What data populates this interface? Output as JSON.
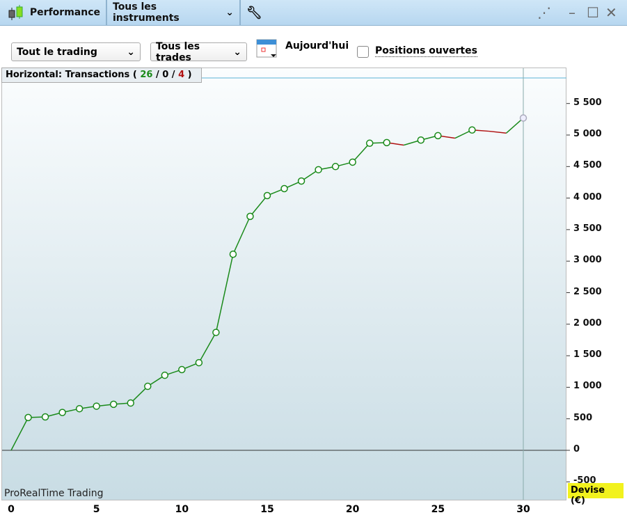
{
  "topbar": {
    "title": "Performance",
    "instruments": "Tous les instruments",
    "instruments_chevron": "⌄"
  },
  "filters": {
    "scope": "Tout le trading",
    "trades": "Tous les trades",
    "date": "Aujourd'hui",
    "open_positions": "Positions ouvertes",
    "open_positions_checked": false
  },
  "legend": {
    "prefix": "Horizontal: Transactions",
    "open": "(",
    "wins": "26",
    "sep1": "/",
    "neutral": "0",
    "sep2": "/",
    "losses": "4",
    "close": ")"
  },
  "watermark": "ProRealTime Trading",
  "currency": "Devise (€)",
  "colors": {
    "win": "#1a8a1a",
    "loss": "#b01010",
    "current": "#aab"
  },
  "chart_data": {
    "type": "line",
    "xlabel": "Transactions",
    "ylabel": "Devise (€)",
    "xlim": [
      0,
      32
    ],
    "ylim": [
      -500,
      5900
    ],
    "x_ticks": [
      0,
      5,
      10,
      15,
      20,
      25,
      30
    ],
    "y_ticks": [
      -500,
      0,
      500,
      1000,
      1500,
      2000,
      2500,
      3000,
      3500,
      4000,
      4500,
      5000,
      5500
    ],
    "y_tick_labels": [
      "-500",
      "0",
      "500",
      "1 000",
      "1 500",
      "2 000",
      "2 500",
      "3 000",
      "3 500",
      "4 000",
      "4 500",
      "5 000",
      "5 500"
    ],
    "x": [
      0,
      1,
      2,
      3,
      4,
      5,
      6,
      7,
      8,
      9,
      10,
      11,
      12,
      13,
      14,
      15,
      16,
      17,
      18,
      19,
      20,
      21,
      22,
      23,
      24,
      25,
      26,
      27,
      28,
      29,
      30
    ],
    "y": [
      0,
      520,
      530,
      600,
      660,
      700,
      730,
      750,
      1015,
      1190,
      1280,
      1390,
      1870,
      3110,
      3710,
      4040,
      4150,
      4270,
      4450,
      4500,
      4570,
      4870,
      4880,
      4840,
      4920,
      4990,
      4950,
      5080,
      5060,
      5030,
      5270
    ],
    "cursor_x": 30
  }
}
